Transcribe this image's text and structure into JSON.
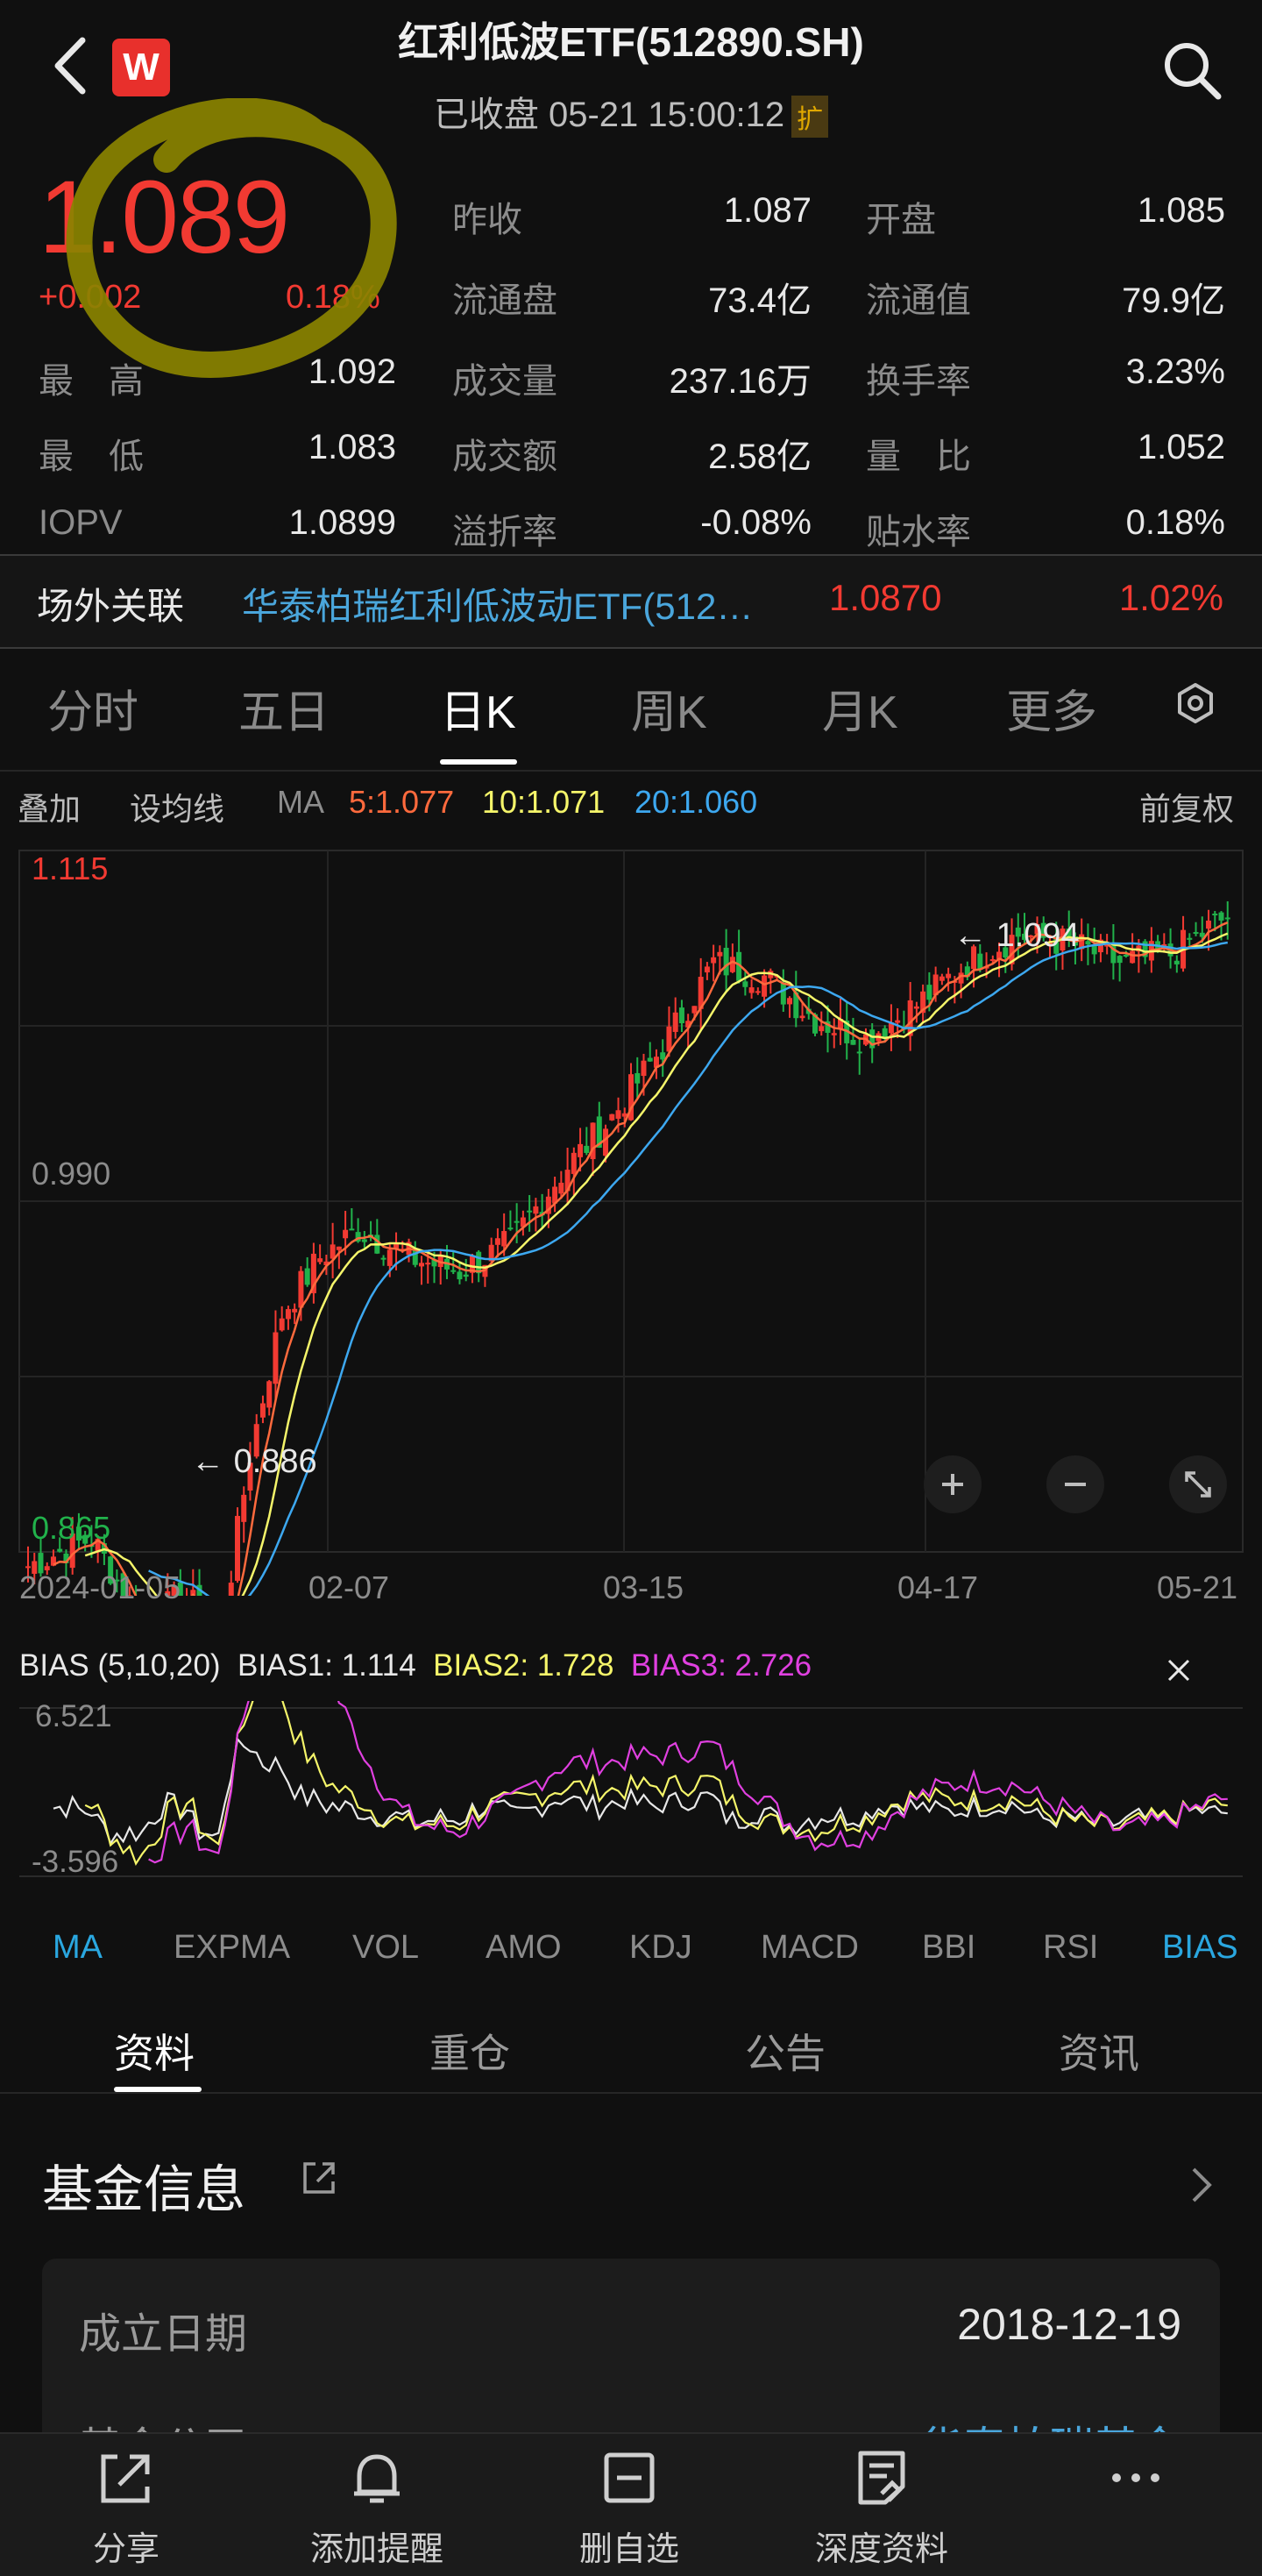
{
  "header": {
    "title": "红利低波ETF(512890.SH)",
    "status": "已收盘 05-21 15:00:12",
    "expand_badge": "扩"
  },
  "quote": {
    "price": "1.089",
    "change": "+0.002",
    "change_pct": "0.18%",
    "rows": [
      [
        {
          "label": "最　高",
          "value": "1.092"
        },
        {
          "label": "昨收",
          "value": "1.087"
        },
        {
          "label": "开盘",
          "value": "1.085"
        }
      ],
      [
        {
          "label": "",
          "value": ""
        },
        {
          "label": "流通盘",
          "value": "73.4亿"
        },
        {
          "label": "流通值",
          "value": "79.9亿"
        }
      ],
      [
        {
          "label": "最　低",
          "value": "1.083"
        },
        {
          "label": "成交量",
          "value": "237.16万"
        },
        {
          "label": "换手率",
          "value": "3.23%"
        }
      ],
      [
        {
          "label": "IOPV",
          "value": "1.0899"
        },
        {
          "label": "成交额",
          "value": "2.58亿"
        },
        {
          "label": "量　比",
          "value": "1.052"
        }
      ],
      [
        {
          "label": "",
          "value": ""
        },
        {
          "label": "溢折率",
          "value": "-0.08%"
        },
        {
          "label": "贴水率",
          "value": "0.18%"
        }
      ]
    ],
    "high_label": "最　高",
    "high_value": "1.092",
    "low_label": "最　低",
    "low_value": "1.083",
    "iopv_label": "IOPV",
    "iopv_value": "1.0899",
    "c2": [
      {
        "label": "昨收",
        "value": "1.087"
      },
      {
        "label": "流通盘",
        "value": "73.4亿"
      },
      {
        "label": "成交量",
        "value": "237.16万"
      },
      {
        "label": "成交额",
        "value": "2.58亿"
      },
      {
        "label": "溢折率",
        "value": "-0.08%"
      }
    ],
    "c3": [
      {
        "label": "开盘",
        "value": "1.085"
      },
      {
        "label": "流通值",
        "value": "79.9亿"
      },
      {
        "label": "换手率",
        "value": "3.23%"
      },
      {
        "label": "量　比",
        "value": "1.052"
      },
      {
        "label": "贴水率",
        "value": "0.18%"
      }
    ]
  },
  "related": {
    "label": "场外关联",
    "name": "华泰柏瑞红利低波动ETF(512…",
    "price": "1.0870",
    "pct": "1.02%"
  },
  "tabs": [
    "分时",
    "五日",
    "日K",
    "周K",
    "月K",
    "更多"
  ],
  "active_tab": "日K",
  "ma_bar": {
    "overlay": "叠加",
    "set_ma": "设均线",
    "ma": "MA",
    "ma5": "5:1.077",
    "ma10": "10:1.071",
    "ma20": "20:1.060",
    "adjust": "前复权"
  },
  "kline": {
    "y_max_label": "1.115",
    "y_mid_label": "0.990",
    "y_min_label": "0.865",
    "high_marker": "1.094",
    "low_marker": "0.886",
    "dates": [
      "2024-01-05",
      "02-07",
      "03-15",
      "04-17",
      "05-21"
    ]
  },
  "bias": {
    "title": "BIAS (5,10,20)",
    "bias1": "BIAS1: 1.114",
    "bias2": "BIAS2: 1.728",
    "bias3": "BIAS3: 2.726",
    "top": "6.521",
    "bottom": "-3.596"
  },
  "indicators": [
    "MA",
    "EXPMA",
    "VOL",
    "AMO",
    "KDJ",
    "MACD",
    "BBI",
    "RSI",
    "BIAS"
  ],
  "info_tabs": [
    "资料",
    "重仓",
    "公告",
    "资讯"
  ],
  "fund_info": {
    "title": "基金信息",
    "established_label": "成立日期",
    "established_value": "2018-12-19",
    "company_label": "基金公司",
    "company_value": "华泰柏瑞基金"
  },
  "bottom_nav": [
    "分享",
    "添加提醒",
    "删自选",
    "深度资料",
    "更多"
  ],
  "colors": {
    "up": "#f23a32",
    "down": "#21b24b",
    "ma5": "#ff6a3d",
    "ma10": "#f5f56a",
    "ma20": "#3da8f0",
    "bias3": "#e040e0",
    "accent": "#2aa7e0"
  }
}
